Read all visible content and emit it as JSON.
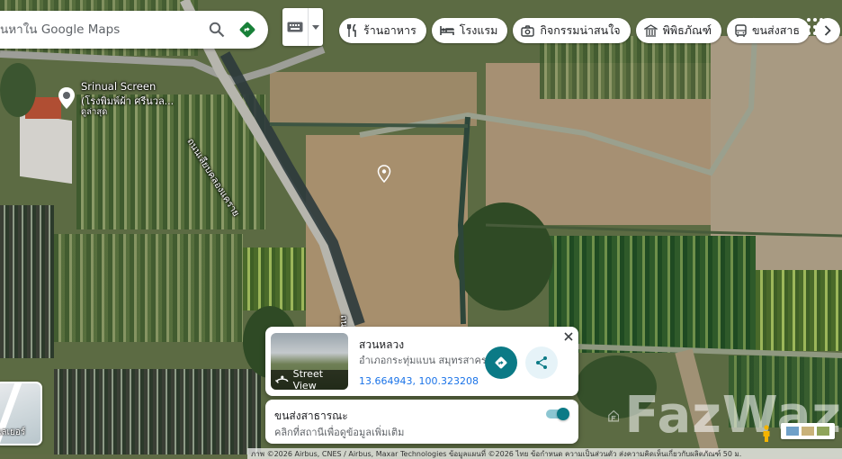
{
  "search": {
    "placeholder": "นหาใน Google Maps"
  },
  "chips": [
    {
      "label": "ร้านอาหาร",
      "icon": "fork-knife-icon"
    },
    {
      "label": "โรงแรม",
      "icon": "bed-icon"
    },
    {
      "label": "กิจกรรมน่าสนใจ",
      "icon": "camera-icon"
    },
    {
      "label": "พิพิธภัณฑ์",
      "icon": "museum-icon"
    },
    {
      "label": "ขนส่งสาธ",
      "icon": "bus-icon"
    }
  ],
  "map_labels": {
    "poi_name": "Srinual Screen",
    "poi_sub": "(โรงพิมพ์ผ้า ศรีนวล...",
    "poi_note": "ดูล่าสุด",
    "road": "ถนนเลียบคลองแคราย",
    "road_fragment": "ถน"
  },
  "place_card": {
    "title": "สวนหลวง",
    "subtitle": "อำเภอกระทุ่มแบน สมุทรสาคร",
    "coords": "13.664943, 100.323208",
    "streetview_label": "Street View"
  },
  "transit_card": {
    "title": "ขนส่งสาธารณะ",
    "subtitle": "คลิกที่สถานีเพื่อดูข้อมูลเพิ่มเติม",
    "toggle_on": true
  },
  "layers_thumb": {
    "label": "เลเยอร์"
  },
  "watermark": {
    "text": "FazWaz"
  },
  "attribution": {
    "text": "ภาพ ©2026 Airbus, CNES / Airbus, Maxar Technologies ข้อมูลแผนที่ ©2026   ไทย   ข้อกำหนด   ความเป็นส่วนตัว   ส่งความคิดเห็นเกี่ยวกับผลิตภัณฑ์   50 ม."
  },
  "colors": {
    "accent": "#0b7a86",
    "link": "#1a73e8",
    "directions_green": "#188038"
  }
}
